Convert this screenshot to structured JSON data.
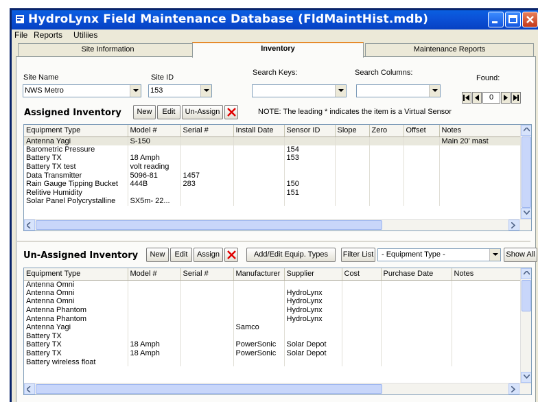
{
  "window": {
    "title": "HydroLynx Field Maintenance Database (FldMaintHist.mdb)"
  },
  "menu": {
    "items": [
      "File",
      "Reports",
      "Utiliies"
    ]
  },
  "tabs": [
    {
      "label": "Site Information",
      "active": false
    },
    {
      "label": "Inventory",
      "active": true
    },
    {
      "label": "Maintenance Reports",
      "active": false
    }
  ],
  "filters": {
    "site_name_label": "Site Name",
    "site_name_value": "NWS Metro",
    "site_id_label": "Site ID",
    "site_id_value": "153",
    "search_keys_label": "Search Keys:",
    "search_keys_value": "",
    "search_columns_label": "Search Columns:",
    "search_columns_value": "",
    "found_label": "Found:",
    "found_value": "0"
  },
  "assigned": {
    "title": "Assigned Inventory",
    "new_label": "New",
    "edit_label": "Edit",
    "unassign_label": "Un-Assign",
    "note": "NOTE: The leading * indicates the item is a Virtual Sensor",
    "columns": [
      "Equipment Type",
      "Model #",
      "Serial #",
      "Install Date",
      "Sensor ID",
      "Slope",
      "Zero",
      "Offset",
      "Notes"
    ],
    "rows": [
      [
        "Antenna Yagi",
        "S-150",
        "",
        "",
        "",
        "",
        "",
        "",
        "Main 20' mast"
      ],
      [
        "Barometric Pressure",
        "",
        "",
        "",
        "154",
        "",
        "",
        "",
        ""
      ],
      [
        "Battery  TX",
        "18 Amph",
        "",
        "",
        "153",
        "",
        "",
        "",
        ""
      ],
      [
        "Battery TX test",
        "volt reading",
        "",
        "",
        "",
        "",
        "",
        "",
        ""
      ],
      [
        "Data Transmitter",
        "5096-81",
        "1457",
        "",
        "",
        "",
        "",
        "",
        ""
      ],
      [
        "Rain Gauge Tipping Bucket",
        "444B",
        "283",
        "",
        "150",
        "",
        "",
        "",
        ""
      ],
      [
        "Relitive Humidity",
        "",
        "",
        "",
        "151",
        "",
        "",
        "",
        ""
      ],
      [
        "Solar Panel Polycrystalline",
        "SX5m- 22...",
        "",
        "",
        "",
        "",
        "",
        "",
        ""
      ]
    ]
  },
  "unassigned": {
    "title": "Un-Assigned Inventory",
    "new_label": "New",
    "edit_label": "Edit",
    "assign_label": "Assign",
    "add_edit_label": "Add/Edit Equip. Types",
    "filter_label": "Filter List",
    "filter_value": "- Equipment Type -",
    "show_all_label": "Show All",
    "columns": [
      "Equipment Type",
      "Model #",
      "Serial #",
      "Manufacturer",
      "Supplier",
      "Cost",
      "Purchase Date",
      "Notes"
    ],
    "rows": [
      [
        "Antenna Omni",
        "",
        "",
        "",
        "",
        "",
        "",
        ""
      ],
      [
        "Antenna Omni",
        "",
        "",
        "",
        "HydroLynx",
        "",
        "",
        ""
      ],
      [
        "Antenna Omni",
        "",
        "",
        "",
        "HydroLynx",
        "",
        "",
        ""
      ],
      [
        "Antenna Phantom",
        "",
        "",
        "",
        "HydroLynx",
        "",
        "",
        ""
      ],
      [
        "Antenna Phantom",
        "",
        "",
        "",
        "HydroLynx",
        "",
        "",
        ""
      ],
      [
        "Antenna Yagi",
        "",
        "",
        "Samco",
        "",
        "",
        "",
        ""
      ],
      [
        "Battery  TX",
        "",
        "",
        "",
        "",
        "",
        "",
        ""
      ],
      [
        "Battery  TX",
        "18 Amph",
        "",
        "PowerSonic",
        "Solar Depot",
        "",
        "",
        ""
      ],
      [
        "Battery  TX",
        "18 Amph",
        "",
        "PowerSonic",
        "Solar Depot",
        "",
        "",
        ""
      ],
      [
        "Battery  wireless float",
        "",
        "",
        "",
        "",
        "",
        "",
        ""
      ]
    ]
  },
  "colors": {
    "title_bar": "#0b52d8",
    "tab_highlight": "#e68b2c",
    "delete_red": "#e00000"
  }
}
